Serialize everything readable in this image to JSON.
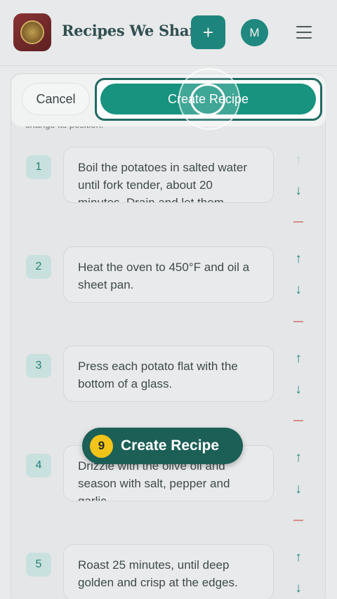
{
  "header": {
    "brand": "Recipes We Share",
    "add_label": "+",
    "avatar_initial": "M"
  },
  "form": {
    "hint": "change its position.",
    "cancel_label": "Cancel",
    "create_label": "Create Recipe"
  },
  "steps": [
    {
      "number": "1",
      "text": "Boil the potatoes in salted water until fork tender, about 20 minutes. Drain and let them"
    },
    {
      "number": "2",
      "text": "Heat the oven to 450°F and oil a sheet pan."
    },
    {
      "number": "3",
      "text": "Press each potato flat with the bottom of a glass."
    },
    {
      "number": "4",
      "text": "Drizzle with the olive oil and season with salt, pepper and garlic."
    },
    {
      "number": "5",
      "text": "Roast 25 minutes, until deep golden and crisp at the edges."
    }
  ],
  "icons": {
    "up": "↑",
    "down": "↓"
  },
  "tutorial": {
    "step_number": "9",
    "label": "Create Recipe"
  }
}
